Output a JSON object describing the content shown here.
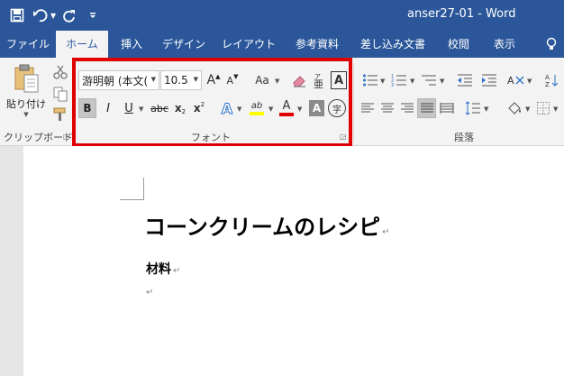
{
  "title_bar": {
    "document_title": "anser27-01  -  Word",
    "quick_access": [
      "save-icon",
      "undo-icon",
      "redo-icon",
      "customize-icon"
    ]
  },
  "tabs": [
    {
      "label": "ファイル",
      "active": false
    },
    {
      "label": "ホーム",
      "active": true
    },
    {
      "label": "挿入",
      "active": false
    },
    {
      "label": "デザイン",
      "active": false
    },
    {
      "label": "レイアウト",
      "active": false
    },
    {
      "label": "参考資料",
      "active": false
    },
    {
      "label": "差し込み文書",
      "active": false
    },
    {
      "label": "校閲",
      "active": false
    },
    {
      "label": "表示",
      "active": false
    }
  ],
  "ribbon": {
    "clipboard": {
      "paste_label": "貼り付け",
      "group_label": "クリップボード"
    },
    "font": {
      "font_name": "游明朝 (本文(",
      "font_size": "10.5",
      "grow_label": "A",
      "shrink_label": "A",
      "case_label": "Aa",
      "clear_label": "A",
      "bold_label": "B",
      "italic_label": "I",
      "underline_label": "U",
      "strike_label": "abc",
      "subscript_label": "x",
      "superscript_label": "x",
      "effects_label": "A",
      "highlight_label": "ab",
      "fontcolor_label": "A",
      "shading_label": "A",
      "enclose_label": "字",
      "group_label": "フォント"
    },
    "paragraph": {
      "group_label": "段落"
    }
  },
  "colors": {
    "accent": "#2b579a",
    "highlight_frame": "#e00000",
    "font_color_bar": "#e00000",
    "highlight_bar": "#ffff00"
  },
  "document": {
    "heading": "コーンクリームのレシピ",
    "subheading": "材料",
    "para_mark": "↵"
  }
}
